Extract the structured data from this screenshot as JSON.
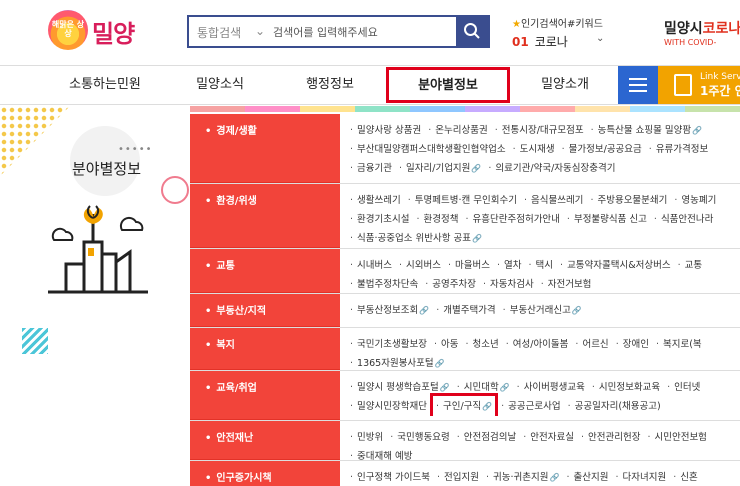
{
  "header": {
    "logo_small": "해맑은 상상",
    "logo_text": "밀양",
    "search": {
      "select_label": "통합검색",
      "placeholder": "검색어를 입력해주세요"
    },
    "keyword": {
      "title": "인기검색어#키워드",
      "rank": "01",
      "term": "코로나"
    },
    "covid": {
      "title_black": "밀양시",
      "title_red": "코로나",
      "sub": "WITH COVID-"
    }
  },
  "nav": {
    "items": [
      "소통하는민원",
      "밀양소식",
      "행정정보",
      "분야별정보",
      "밀양소개"
    ],
    "active": "분야별정보",
    "link_service": {
      "top": "Link Serv",
      "bottom": "1주간 인"
    }
  },
  "left": {
    "title": "분야별정보",
    "dots": "•••••"
  },
  "categories": [
    {
      "name": "경제/생활",
      "lines": [
        [
          {
            "t": "밀양사랑 상품권"
          },
          {
            "t": "온누리상품권"
          },
          {
            "t": "전통시장/대규모점포"
          },
          {
            "t": "농특산물 쇼핑몰 밀양팜",
            "ext": true
          }
        ],
        [
          {
            "t": "부산대밀양캠퍼스대학생활인협약업소"
          },
          {
            "t": "도시재생"
          },
          {
            "t": "물가정보/공공요금"
          },
          {
            "t": "유류가격정보"
          }
        ],
        [
          {
            "t": "금융기관"
          },
          {
            "t": "일자리/기업지원",
            "ext": true
          },
          {
            "t": "의료기관/약국/자동심장충격기"
          }
        ]
      ]
    },
    {
      "name": "환경/위생",
      "lines": [
        [
          {
            "t": "생활쓰레기"
          },
          {
            "t": "투명페트병·캔 무인회수기"
          },
          {
            "t": "음식물쓰레기"
          },
          {
            "t": "주방용오물분쇄기"
          },
          {
            "t": "영농폐기"
          }
        ],
        [
          {
            "t": "환경기초시설"
          },
          {
            "t": "환경정책"
          },
          {
            "t": "유흥단란주점허가안내"
          },
          {
            "t": "부정불량식품 신고"
          },
          {
            "t": "식품안전나라"
          }
        ],
        [
          {
            "t": "식품·공중업소 위반사항 공표",
            "ext": true
          }
        ]
      ]
    },
    {
      "name": "교통",
      "lines": [
        [
          {
            "t": "시내버스"
          },
          {
            "t": "시외버스"
          },
          {
            "t": "마을버스"
          },
          {
            "t": "열차"
          },
          {
            "t": "택시"
          },
          {
            "t": "교통약자콜택시&저상버스"
          },
          {
            "t": "교통"
          }
        ],
        [
          {
            "t": "불법주정차단속"
          },
          {
            "t": "공영주차장"
          },
          {
            "t": "자동차검사"
          },
          {
            "t": "자전거보험"
          }
        ]
      ]
    },
    {
      "name": "부동산/지적",
      "lines": [
        [
          {
            "t": "부동산정보조회",
            "ext": true
          },
          {
            "t": "개별주택가격"
          },
          {
            "t": "부동산거래신고",
            "ext": true
          }
        ]
      ]
    },
    {
      "name": "복지",
      "lines": [
        [
          {
            "t": "국민기초생활보장"
          },
          {
            "t": "아동"
          },
          {
            "t": "청소년"
          },
          {
            "t": "여성/아이돌봄"
          },
          {
            "t": "어르신"
          },
          {
            "t": "장애인"
          },
          {
            "t": "복지로(복"
          }
        ],
        [
          {
            "t": "1365자원봉사포털",
            "ext": true
          }
        ]
      ]
    },
    {
      "name": "교육/취업",
      "lines": [
        [
          {
            "t": "밀양시 평생학습포털",
            "ext": true
          },
          {
            "t": "시민대학",
            "ext": true
          },
          {
            "t": "사이버평생교육"
          },
          {
            "t": "시민정보화교육"
          },
          {
            "t": "인터넷"
          }
        ],
        [
          {
            "t": "밀양시민장학재단"
          },
          {
            "t": "구인/구직",
            "ext": true,
            "hl": true
          },
          {
            "t": "공공근로사업"
          },
          {
            "t": "공공일자리(채용공고)"
          }
        ]
      ]
    },
    {
      "name": "안전재난",
      "lines": [
        [
          {
            "t": "민방위"
          },
          {
            "t": "국민행동요령"
          },
          {
            "t": "안전점검의날"
          },
          {
            "t": "안전자료실"
          },
          {
            "t": "안전관리헌장"
          },
          {
            "t": "시민안전보험"
          }
        ],
        [
          {
            "t": "중대재해 예방"
          }
        ]
      ]
    },
    {
      "name": "인구증가시책",
      "lines": [
        [
          {
            "t": "인구정책 가이드북"
          },
          {
            "t": "전입지원"
          },
          {
            "t": "귀농·귀촌지원",
            "ext": true
          },
          {
            "t": "출산지원"
          },
          {
            "t": "다자녀지원"
          },
          {
            "t": "신혼"
          }
        ]
      ]
    }
  ],
  "colors": {
    "accent_red": "#f2443a",
    "nav_blue": "#2b66d0",
    "highlight": "#e0001b"
  }
}
